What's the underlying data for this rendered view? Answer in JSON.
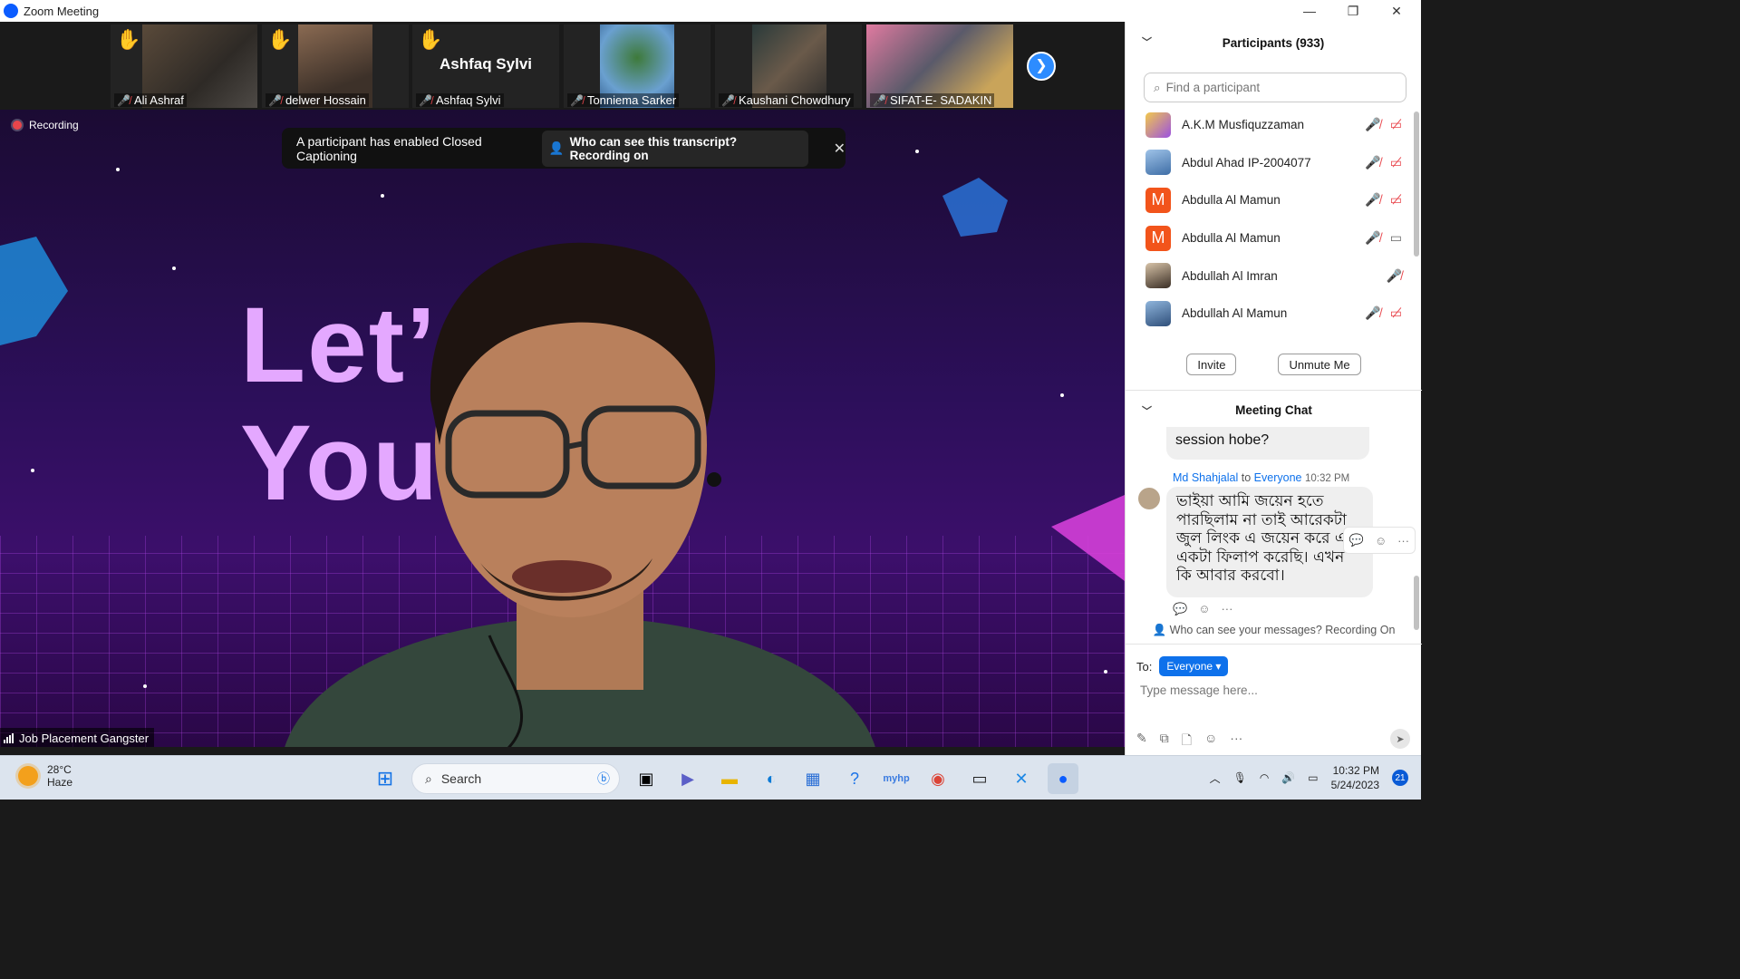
{
  "window": {
    "title": "Zoom Meeting",
    "minimize": "—",
    "restore": "❐",
    "close": "✕"
  },
  "thumbnails": [
    {
      "name": "Ali Ashraf",
      "hand": true,
      "muted": true,
      "video": true
    },
    {
      "name": "delwer Hossain",
      "hand": true,
      "muted": true,
      "video": true
    },
    {
      "name": "Ashfaq Sylvi",
      "display": "Ashfaq Sylvi",
      "hand": true,
      "muted": true,
      "video": false
    },
    {
      "name": "Tonniema Sarker",
      "hand": false,
      "muted": true,
      "video": true
    },
    {
      "name": "Kaushani Chowdhury",
      "hand": false,
      "muted": true,
      "video": true
    },
    {
      "name": "SIFAT-E- SADAKIN",
      "hand": false,
      "muted": true,
      "video": true
    }
  ],
  "recording": {
    "label": "Recording"
  },
  "cc_banner": {
    "text": "A participant has enabled Closed Captioning",
    "pill": "Who can see this transcript? Recording on",
    "close": "✕"
  },
  "main_video": {
    "background_text_line1": "Let’s   le_",
    "background_text_line2": "You       eer",
    "speaker": "Job Placement Gangster"
  },
  "participants": {
    "title": "Participants (933)",
    "search_placeholder": "Find a participant",
    "list": [
      {
        "name": "A.K.M Musfiquzzaman",
        "avatar": "image",
        "color": "#e9a23b",
        "mic_muted": true,
        "video_off": true
      },
      {
        "name": "Abdul Ahad IP-2004077",
        "avatar": "image",
        "color": "#5b93c8",
        "mic_muted": true,
        "video_off": true
      },
      {
        "name": "Abdulla Al Mamun",
        "avatar": "M",
        "color": "#f2541b",
        "mic_muted": true,
        "video_off": true
      },
      {
        "name": "Abdulla Al Mamun",
        "avatar": "M",
        "color": "#f2541b",
        "mic_muted": true,
        "video_off": false
      },
      {
        "name": "Abdullah Al Imran",
        "avatar": "image",
        "color": "#7a6a58",
        "mic_muted": true,
        "video_off": null
      },
      {
        "name": "Abdullah Al Mamun",
        "avatar": "image",
        "color": "#4a73a8",
        "mic_muted": true,
        "video_off": true
      }
    ],
    "invite": "Invite",
    "unmute_me": "Unmute Me"
  },
  "chat": {
    "title": "Meeting Chat",
    "prev_message": "session hobe?",
    "sender": "Md Shahjalal",
    "to_word": "to",
    "recipient": "Everyone",
    "time": "10:32 PM",
    "message": "ভাইয়া আমি জয়েন হতে পারছিলাম না তাই আরেকটা জুল লিংক এ জয়েন করে এ একটা ফিলাপ করেছি। এখন কি আবার করবো।",
    "who_can_see": "Who can see your messages? Recording On",
    "to_label": "To:",
    "to_value": "Everyone",
    "input_placeholder": "Type message here..."
  },
  "taskbar": {
    "temp": "28°C",
    "weather": "Haze",
    "search": "Search",
    "time": "10:32 PM",
    "date": "5/24/2023",
    "notifications": "21"
  }
}
